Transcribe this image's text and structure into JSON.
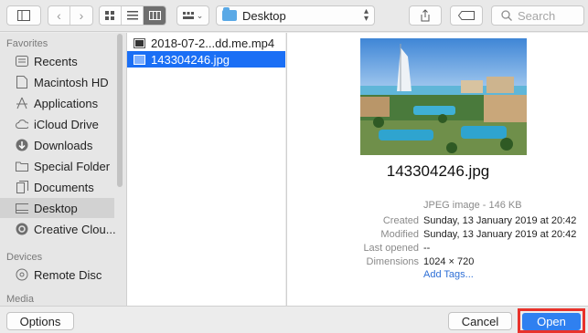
{
  "toolbar": {
    "location_label": "Desktop",
    "search_placeholder": "Search",
    "view_modes": [
      "icon-view-icon",
      "list-view-icon",
      "column-view-icon"
    ],
    "active_view": "column-view-icon"
  },
  "sidebar": {
    "favorites_heading": "Favorites",
    "favorites": [
      {
        "label": "Recents",
        "icon": "recents-icon"
      },
      {
        "label": "Macintosh HD",
        "icon": "disk-icon"
      },
      {
        "label": "Applications",
        "icon": "applications-icon"
      },
      {
        "label": "iCloud Drive",
        "icon": "cloud-icon"
      },
      {
        "label": "Downloads",
        "icon": "downloads-icon"
      },
      {
        "label": "Special Folder",
        "icon": "folder-icon"
      },
      {
        "label": "Documents",
        "icon": "documents-icon"
      },
      {
        "label": "Desktop",
        "icon": "desktop-icon",
        "selected": true
      },
      {
        "label": "Creative Clou...",
        "icon": "creative-cloud-icon"
      }
    ],
    "devices_heading": "Devices",
    "devices": [
      {
        "label": "Remote Disc",
        "icon": "disc-icon"
      }
    ],
    "media_heading": "Media"
  },
  "files": [
    {
      "name": "2018-07-2...dd.me.mp4",
      "icon": "video-file-icon",
      "selected": false
    },
    {
      "name": "143304246.jpg",
      "icon": "image-file-icon",
      "selected": true
    }
  ],
  "preview": {
    "file_name": "143304246.jpg",
    "kind": "JPEG image - 146 KB",
    "created_label": "Created",
    "created_value": "Sunday, 13 January 2019 at 20:42",
    "modified_label": "Modified",
    "modified_value": "Sunday, 13 January 2019 at 20:42",
    "last_opened_label": "Last opened",
    "last_opened_value": "--",
    "dimensions_label": "Dimensions",
    "dimensions_value": "1024 × 720",
    "add_tags": "Add Tags..."
  },
  "buttons": {
    "options": "Options",
    "cancel": "Cancel",
    "open": "Open"
  },
  "colors": {
    "selection": "#1b6ff5",
    "open_button": "#2f80f0",
    "highlight_outline": "#e8322b"
  }
}
